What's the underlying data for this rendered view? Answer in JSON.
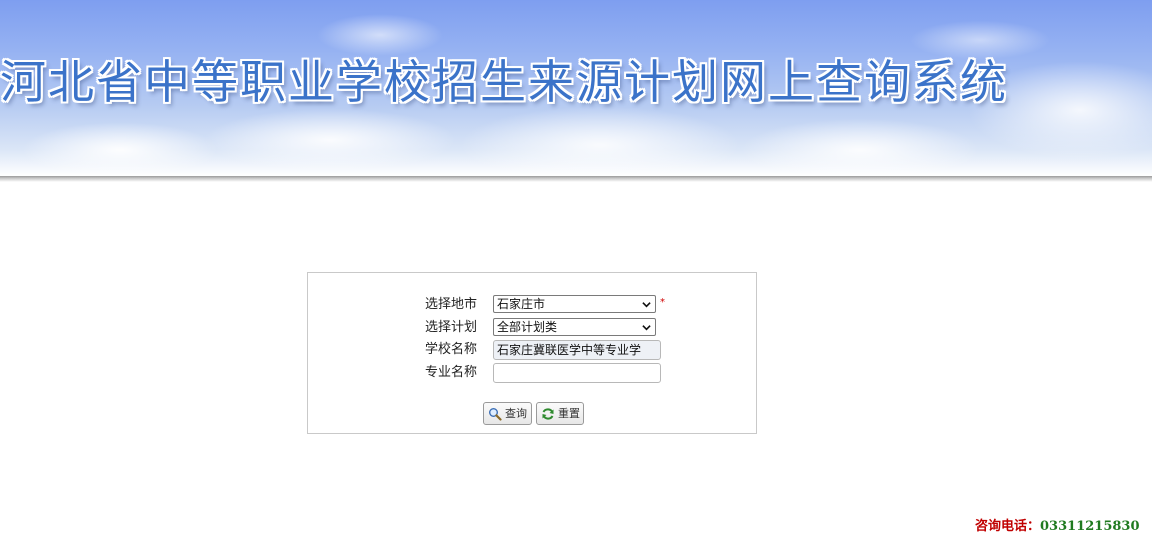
{
  "banner": {
    "title": "河北省中等职业学校招生来源计划网上查询系统"
  },
  "form": {
    "city": {
      "label": "选择地市",
      "value": "石家庄市",
      "required_mark": "*"
    },
    "plan": {
      "label": "选择计划",
      "value": "全部计划类"
    },
    "school": {
      "label": "学校名称",
      "value": "石家庄冀联医学中等专业学"
    },
    "major": {
      "label": "专业名称",
      "value": ""
    },
    "buttons": {
      "search": "查询",
      "reset": "重置"
    }
  },
  "footer": {
    "contact_label": "咨询电话：",
    "contact_number": "03311215830"
  },
  "colors": {
    "title_blue": "#3b73c9",
    "required_red": "#d00000",
    "contact_red": "#c00000",
    "contact_green": "#1f7a1f"
  }
}
